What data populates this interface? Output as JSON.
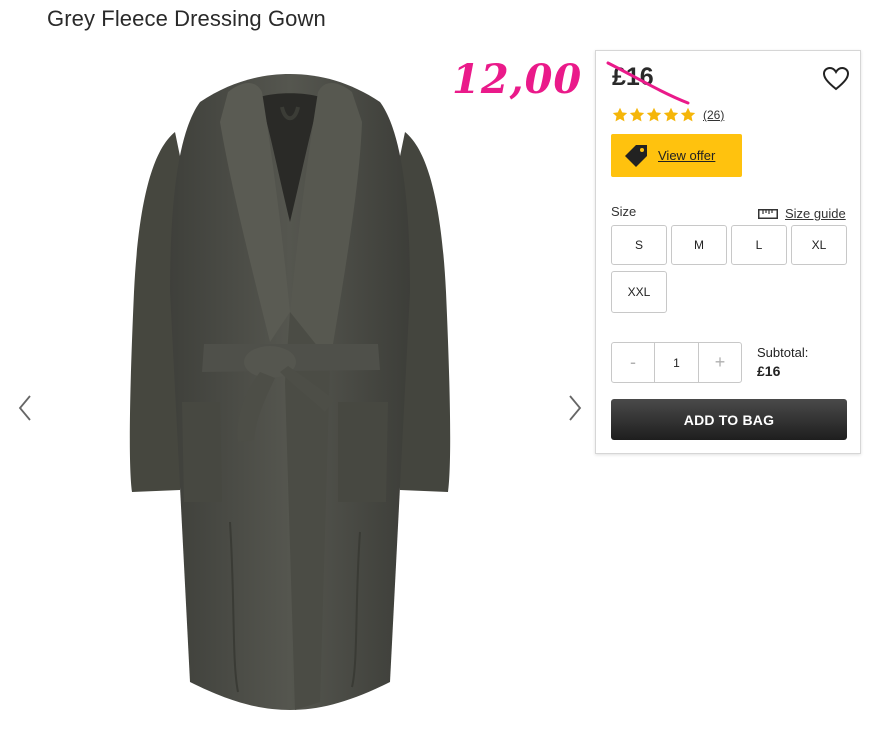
{
  "product": {
    "title": "Grey Fleece Dressing Gown",
    "image_alt": "Grey fleece dressing gown with shawl collar and belt"
  },
  "promo": {
    "price": "12,00",
    "color": "#ea1a8a"
  },
  "panel": {
    "price": "£16",
    "rating": {
      "stars": 5,
      "count": "(26)",
      "star_color": "#f5b60a"
    },
    "offer": {
      "label": "View offer",
      "color": "#ffc20e"
    },
    "size": {
      "label": "Size",
      "guide_label": "Size guide",
      "options": [
        "S",
        "M",
        "L",
        "XL",
        "XXL"
      ]
    },
    "quantity": {
      "minus": "-",
      "value": "1",
      "plus": "+"
    },
    "subtotal": {
      "label": "Subtotal:",
      "value": "£16"
    },
    "add_to_bag_label": "ADD TO BAG"
  },
  "icons": {
    "gallery_prev": "chevron-left-icon",
    "gallery_next": "chevron-right-icon",
    "wishlist": "heart-outline-icon",
    "offer": "price-tag-icon",
    "size_guide": "ruler-icon",
    "rating": "star-icon"
  }
}
